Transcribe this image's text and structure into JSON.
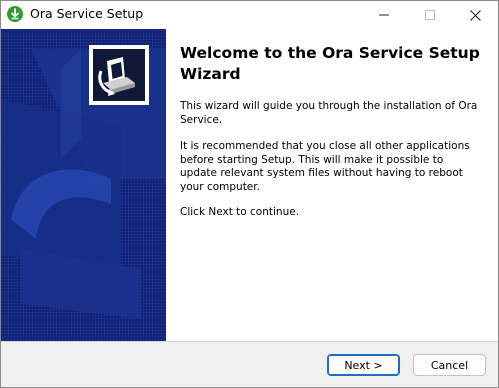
{
  "window": {
    "title": "Ora Service Setup",
    "icons": [
      "download-arrow-icon",
      "minimize-icon",
      "maximize-icon",
      "close-icon"
    ]
  },
  "sidebar": {
    "logo_icon": "installer-box-icon",
    "colors": {
      "background": "#102070",
      "accent": "#2e4fc0"
    }
  },
  "content": {
    "heading": "Welcome to the Ora Service Setup Wizard",
    "paragraph_1": "This wizard will guide you through the installation of Ora Service.",
    "paragraph_2": "It is recommended that you close all other applications before starting Setup. This will make it possible to update relevant system files without having to reboot your computer.",
    "paragraph_3": "Click Next to continue."
  },
  "buttons": {
    "next": "Next >",
    "cancel": "Cancel"
  }
}
